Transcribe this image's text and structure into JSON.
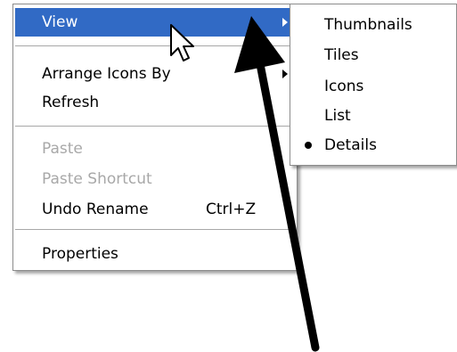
{
  "context_menu": {
    "items": [
      {
        "label": "View",
        "has_submenu": true,
        "highlighted": true
      },
      {
        "label": "Arrange Icons By",
        "has_submenu": true
      },
      {
        "label": "Refresh"
      },
      {
        "label": "Paste",
        "disabled": true
      },
      {
        "label": "Paste Shortcut",
        "disabled": true
      },
      {
        "label": "Undo Rename",
        "shortcut": "Ctrl+Z"
      },
      {
        "label": "Properties"
      }
    ]
  },
  "view_submenu": {
    "items": [
      {
        "label": "Thumbnails"
      },
      {
        "label": "Tiles"
      },
      {
        "label": "Icons"
      },
      {
        "label": "List"
      },
      {
        "label": "Details",
        "selected": true
      }
    ]
  },
  "colors": {
    "highlight": "#316ac5",
    "disabled_text": "#a8a8a8",
    "annotation_arrow": "#000000"
  },
  "icons": {
    "pointer": "mouse-pointer-icon",
    "annotation": "annotation-arrow-icon",
    "submenu": "submenu-arrow-icon",
    "radio": "radio-bullet-icon"
  }
}
